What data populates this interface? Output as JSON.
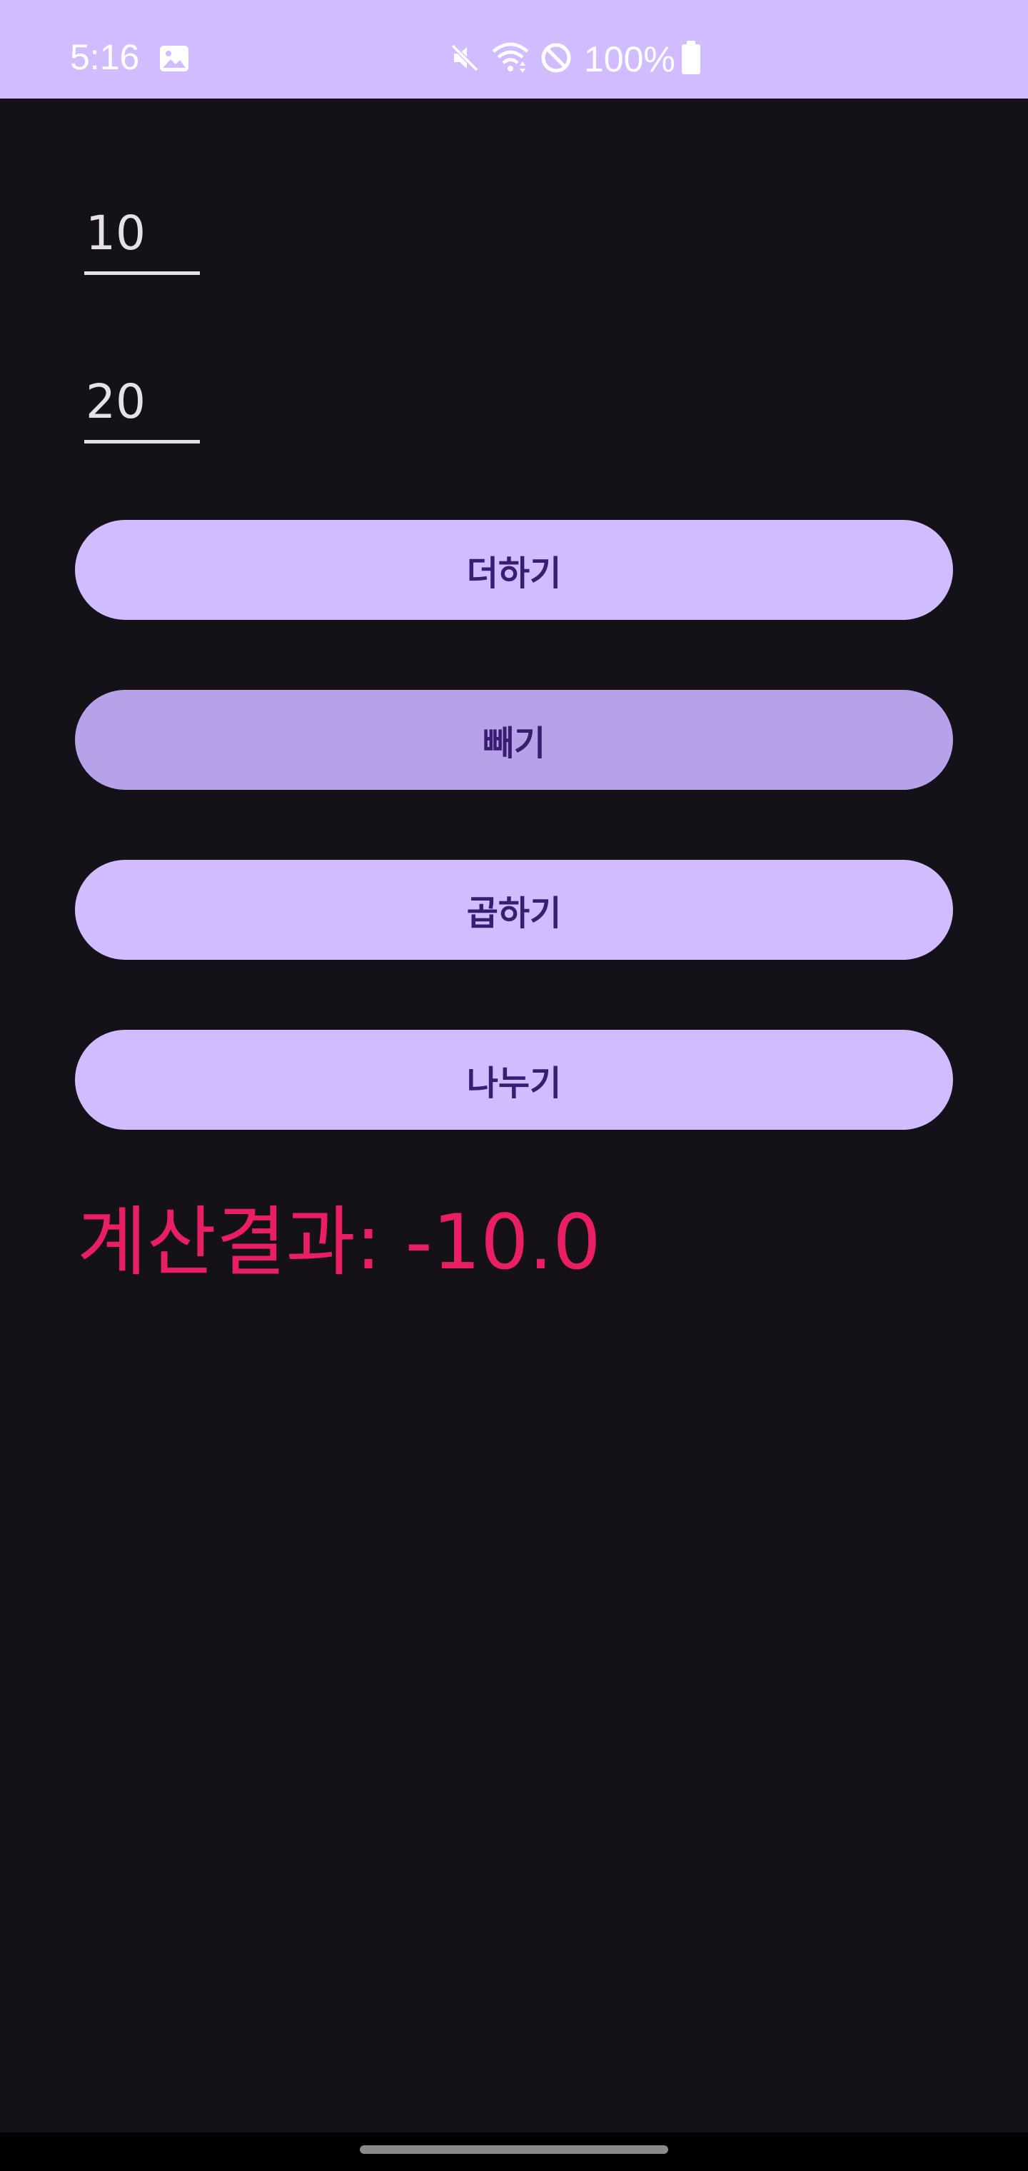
{
  "status_bar": {
    "time": "5:16",
    "battery_percent": "100%",
    "icons": [
      "gallery-icon",
      "mute-icon",
      "wifi-icon",
      "do-not-disturb-icon",
      "battery-icon"
    ],
    "background_color": "#d0bcff"
  },
  "inputs": {
    "first_value": "10",
    "second_value": "20"
  },
  "buttons": {
    "add": "더하기",
    "subtract": "빼기",
    "multiply": "곱하기",
    "divide": "나누기"
  },
  "result": {
    "text": "계산결과: -10.0",
    "color": "#e91e63"
  },
  "colors": {
    "background": "#141218",
    "button": "#d0bcff",
    "button_pressed": "#b7a2ea",
    "button_text": "#381e72"
  }
}
